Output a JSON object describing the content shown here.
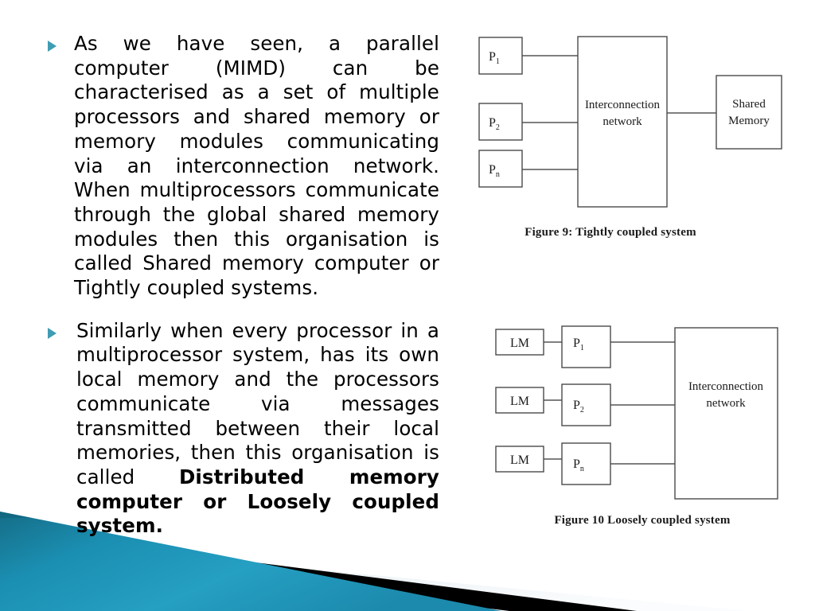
{
  "slide": {
    "background_color": "#ffffff",
    "accent_color": "#1b94b8",
    "bullet_color": "#3f9cb2"
  },
  "content": {
    "bullets": [
      {
        "marker": "triangle-bullet",
        "text_plain": "As we have seen, a parallel computer (MIMD) can be characterised as a set of multiple processors and shared memory or memory modules communicating via an interconnection network. When multiprocessors communicate through the global shared memory modules then this organisation is called Shared memory computer or Tightly coupled systems.",
        "runs": [
          {
            "text": "As we have seen, a parallel computer (MIMD) can be characterised as a set of multiple processors and shared memory or memory modules communicating via an interconnection network. When multiprocessors communicate through the global shared memory modules then this organisation is called Shared memory computer or Tightly coupled systems.",
            "bold": false
          }
        ]
      },
      {
        "marker": "triangle-bullet",
        "text_plain": "Similarly when every processor in a multiprocessor system, has its own local memory and the processors communicate via messages transmitted between their local memories, then this organisation is called Distributed memory computer or Loosely coupled system.",
        "runs": [
          {
            "text": "Similarly when every processor in a multiprocessor system, has its own local memory and the processors communicate via messages transmitted between their local memories, then this organisation is called ",
            "bold": false
          },
          {
            "text": "Distributed memory computer or Loosely coupled system.",
            "bold": true
          }
        ]
      }
    ]
  },
  "figure9": {
    "caption": "Figure 9: Tightly coupled system",
    "processors": [
      "P",
      "P",
      "P"
    ],
    "processor_labels": [
      {
        "base": "P",
        "sub": "1"
      },
      {
        "base": "P",
        "sub": "2"
      },
      {
        "base": "P",
        "sub": "n"
      }
    ],
    "network_label_line1": "Interconnection",
    "network_label_line2": "network",
    "memory_label_line1": "Shared",
    "memory_label_line2": "Memory"
  },
  "figure10": {
    "caption": "Figure 10 Loosely coupled system",
    "local_memory_label": "LM",
    "local_memories": [
      "LM",
      "LM",
      "LM"
    ],
    "processor_labels": [
      {
        "base": "P",
        "sub": "1"
      },
      {
        "base": "P",
        "sub": "2"
      },
      {
        "base": "P",
        "sub": "n"
      }
    ],
    "network_label_line1": "Interconnection",
    "network_label_line2": "network"
  }
}
